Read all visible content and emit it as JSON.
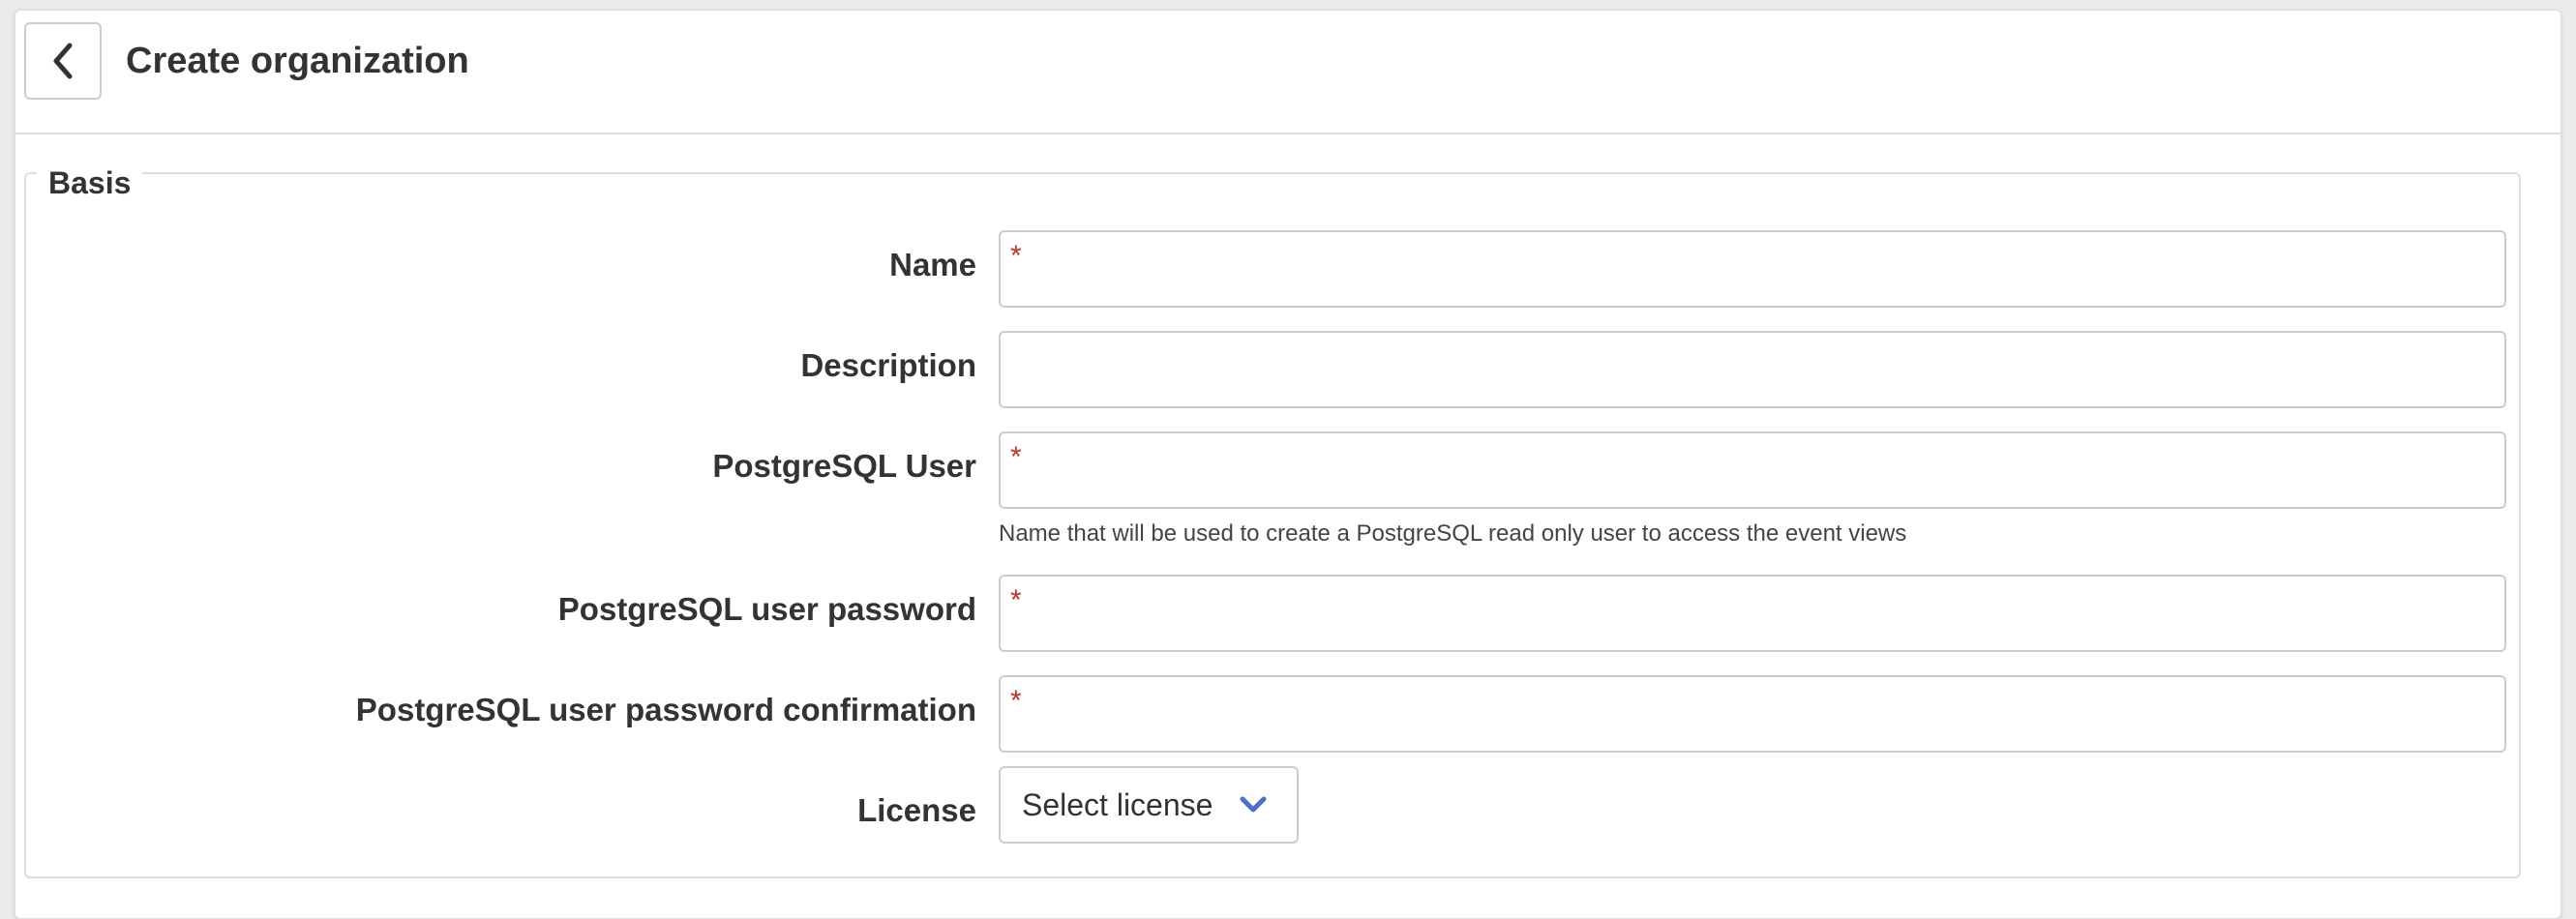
{
  "header": {
    "title": "Create organization",
    "back_icon": "chevron-left-icon"
  },
  "section": {
    "legend": "Basis"
  },
  "fields": {
    "name": {
      "label": "Name",
      "required": true,
      "value": ""
    },
    "description": {
      "label": "Description",
      "required": false,
      "value": ""
    },
    "pg_user": {
      "label": "PostgreSQL User",
      "required": true,
      "value": "",
      "help": "Name that will be used to create a PostgreSQL read only user to access the event views"
    },
    "pg_password": {
      "label": "PostgreSQL user password",
      "required": true,
      "value": ""
    },
    "pg_password_confirm": {
      "label": "PostgreSQL user password confirmation",
      "required": true,
      "value": ""
    },
    "license": {
      "label": "License",
      "selected": "Select license",
      "icon": "chevron-down-icon"
    }
  },
  "required_marker": "*",
  "colors": {
    "required": "#c9302c",
    "chevron": "#4a6fd1",
    "border": "#cccccc",
    "text": "#333333"
  }
}
